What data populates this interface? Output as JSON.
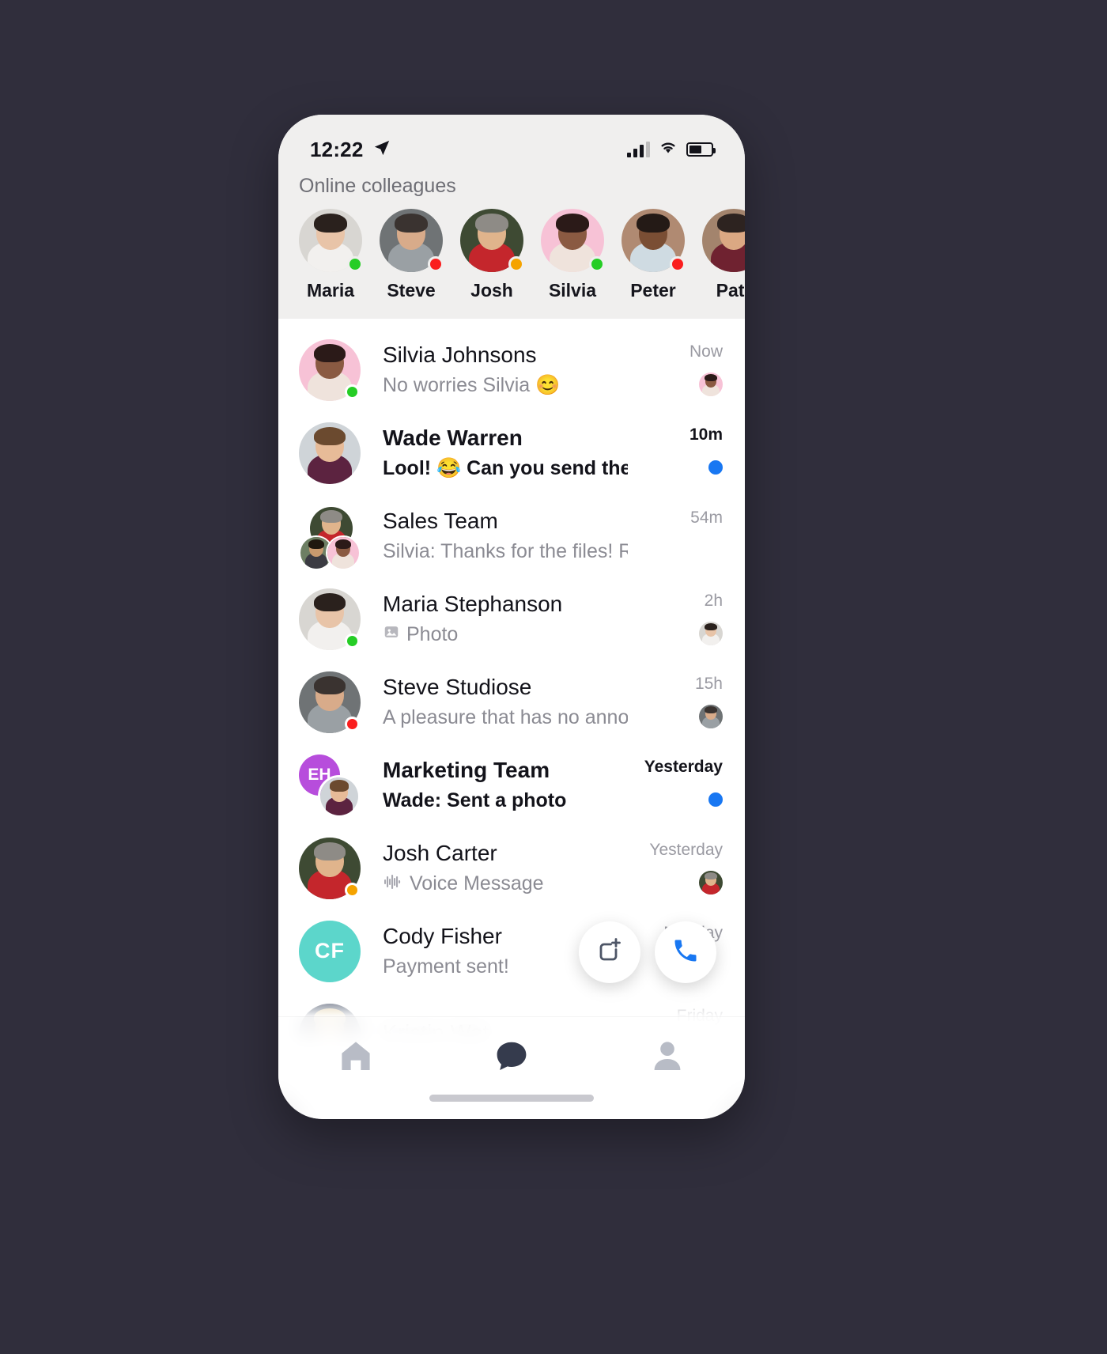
{
  "status_bar": {
    "time": "12:22",
    "location_icon": "location-arrow-icon",
    "signal_icon": "cellular-signal-icon",
    "wifi_icon": "wifi-icon",
    "battery_icon": "battery-icon"
  },
  "stories": {
    "title": "Online colleagues",
    "items": [
      {
        "name": "Maria",
        "status": "green",
        "bg": "#d8d6d2",
        "skin": "#e8c4a8",
        "hair": "#2a211d",
        "shirt": "#f2f0ee"
      },
      {
        "name": "Steve",
        "status": "red",
        "bg": "#6f7375",
        "skin": "#d8ab8a",
        "hair": "#3a3330",
        "shirt": "#9aa0a4"
      },
      {
        "name": "Josh",
        "status": "orange",
        "bg": "#3e4a33",
        "skin": "#e0b48c",
        "hair": "#8e8b86",
        "shirt": "#c4262c"
      },
      {
        "name": "Silvia",
        "status": "green",
        "bg": "#f7c2d6",
        "skin": "#8a5a42",
        "hair": "#2b1a18",
        "shirt": "#efe3dc"
      },
      {
        "name": "Peter",
        "status": "red",
        "bg": "#b08a72",
        "skin": "#7a4e34",
        "hair": "#241a16",
        "shirt": "#cfdbe2"
      },
      {
        "name": "Patr",
        "status": "red",
        "bg": "#a3846d",
        "skin": "#dba883",
        "hair": "#2d2320",
        "shirt": "#6f2230"
      }
    ]
  },
  "chats": [
    {
      "name": "Silvia Johnsons",
      "message": "No worries Silvia 😊",
      "time": "Now",
      "unread": false,
      "avatar_type": "photo",
      "presence": "green",
      "meta_icon": "read-receipt-avatar",
      "colors": {
        "bg": "#f7c2d6",
        "skin": "#8a5a42",
        "hair": "#2b1a18",
        "shirt": "#efe3dc"
      }
    },
    {
      "name": "Wade Warren",
      "message": "Lool! 😂 Can you send the invoice tod…",
      "time": "10m",
      "unread": true,
      "avatar_type": "photo",
      "presence": "none",
      "meta_icon": "unread-dot",
      "colors": {
        "bg": "#cfd4d8",
        "skin": "#e7bb98",
        "hair": "#6b4a2f",
        "shirt": "#5c2340"
      }
    },
    {
      "name": "Sales Team",
      "message": "Silvia: Thanks for the files! Really helpful",
      "time": "54m",
      "unread": false,
      "avatar_type": "group",
      "presence": "none",
      "meta_icon": "none",
      "colors": {
        "bg": "#3e4a33",
        "skin": "#e0b48c",
        "hair": "#8e8b86",
        "shirt": "#c4262c"
      }
    },
    {
      "name": "Maria Stephanson",
      "message": "Photo",
      "message_icon": "photo-icon",
      "time": "2h",
      "unread": false,
      "avatar_type": "photo",
      "presence": "green",
      "meta_icon": "read-receipt-avatar",
      "colors": {
        "bg": "#d8d6d2",
        "skin": "#e8c4a8",
        "hair": "#2a211d",
        "shirt": "#f2f0ee"
      }
    },
    {
      "name": "Steve Studiose",
      "message": "A pleasure that has no annoying 😊",
      "time": "15h",
      "unread": false,
      "avatar_type": "photo",
      "presence": "red",
      "meta_icon": "read-receipt-avatar",
      "colors": {
        "bg": "#6f7375",
        "skin": "#d8ab8a",
        "hair": "#3a3330",
        "shirt": "#9aa0a4"
      }
    },
    {
      "name": "Marketing Team",
      "message": "Wade: Sent a photo",
      "time": "Yesterday",
      "unread": true,
      "avatar_type": "group-initials",
      "initials": "EH",
      "initials_color": "#b74ddc",
      "presence": "none",
      "meta_icon": "unread-dot",
      "colors": {
        "bg": "#cfd4d8",
        "skin": "#e7bb98",
        "hair": "#6b4a2f",
        "shirt": "#5c2340"
      }
    },
    {
      "name": "Josh Carter",
      "message": "Voice Message",
      "message_icon": "voice-waveform-icon",
      "time": "Yesterday",
      "unread": false,
      "avatar_type": "photo",
      "presence": "orange",
      "meta_icon": "read-receipt-avatar",
      "colors": {
        "bg": "#3e4a33",
        "skin": "#e0b48c",
        "hair": "#8e8b86",
        "shirt": "#c4262c"
      }
    },
    {
      "name": "Cody Fisher",
      "message": "Payment sent!",
      "time": "Monday",
      "unread": false,
      "avatar_type": "initials",
      "initials": "CF",
      "initials_color": "#5cd6cb",
      "presence": "none",
      "meta_icon": "none",
      "colors": {}
    },
    {
      "name": "Kristin Wat",
      "message": "",
      "time": "Friday",
      "unread": false,
      "avatar_type": "photo",
      "presence": "none",
      "meta_icon": "none",
      "colors": {
        "bg": "#2e3a52",
        "skin": "#e6c39c",
        "hair": "#d9c08a",
        "shirt": "#c4262c"
      }
    }
  ],
  "fab": {
    "new_chat_icon": "new-message-icon",
    "call_icon": "phone-icon",
    "call_color": "#1877f2"
  },
  "bottom_nav": {
    "items": [
      {
        "icon": "home-icon",
        "active": false
      },
      {
        "icon": "chat-icon",
        "active": true
      },
      {
        "icon": "person-icon",
        "active": false
      }
    ]
  },
  "colors": {
    "accent": "#1877f2",
    "online": "#25cd25",
    "busy": "#fa1e1e",
    "away": "#f5a300",
    "backdrop": "#302e3c",
    "header_bg": "#f0efee"
  }
}
